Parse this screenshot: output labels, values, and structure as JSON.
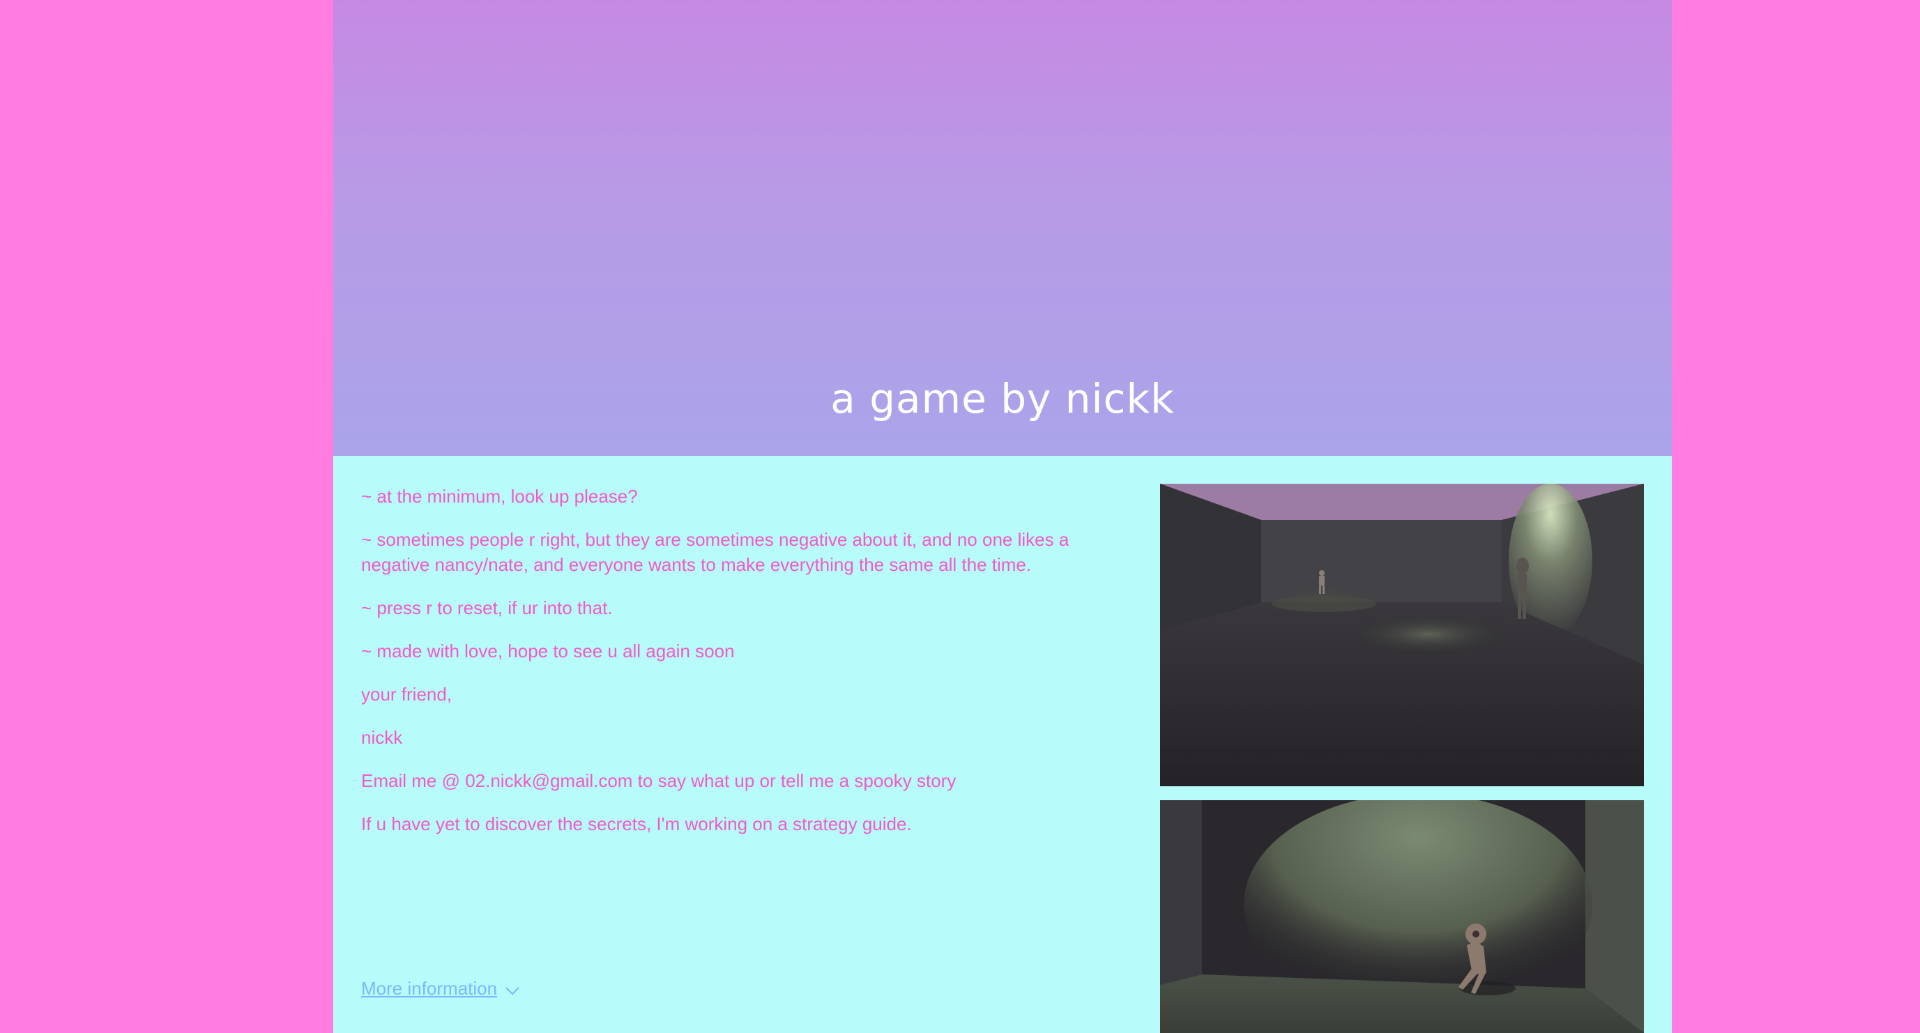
{
  "banner": {
    "title": "a game by nickk"
  },
  "description": {
    "lines": [
      "~ at the minimum, look up please?",
      "~ sometimes people r right, but they are sometimes negative about it, and no one likes a negative nancy/nate, and everyone wants to make everything the same all the time.",
      "~ press r to reset, if ur into that.",
      "~ made with love, hope to see u all again soon",
      "your friend,",
      "nickk",
      "Email me @ 02.nickk@gmail.com to say what up or tell me a spooky story",
      "If u have yet to discover the secrets, I'm working on a strategy guide."
    ]
  },
  "more_info": {
    "label": "More information",
    "icon": "chevron-down-icon"
  },
  "colors": {
    "background": "#ff7ce0",
    "content_bg": "#b8fbfb",
    "text": "#f25ac9",
    "link": "#7ab8ff",
    "banner_top": "#c689e3",
    "banner_bottom": "#aaa4ea"
  }
}
